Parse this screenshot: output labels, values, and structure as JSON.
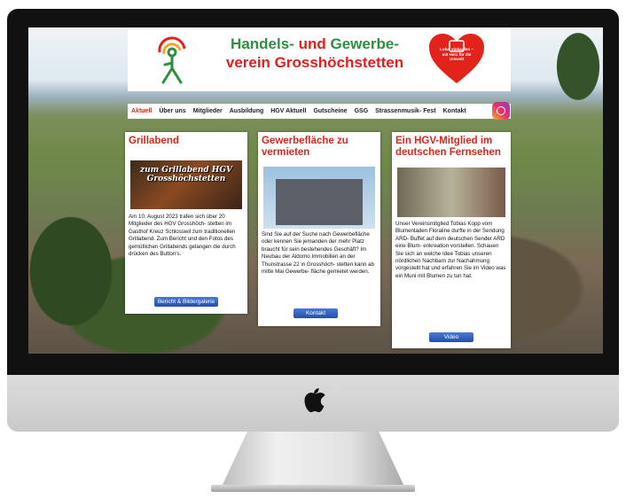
{
  "site": {
    "title_line1_a": "Handels-",
    "title_line1_b": "und",
    "title_line1_c": "Gewerbe-",
    "title_line2": "verein Grosshöchstetten",
    "heart_text": "Lokal einkaufen – mit Herz für die Umwelt"
  },
  "nav": [
    "Aktuell",
    "Über uns",
    "Mitglieder",
    "Ausbildung",
    "HGV Aktuell",
    "Gutscheine",
    "GSG",
    "Strassenmusik- Fest",
    "Kontakt"
  ],
  "cards": [
    {
      "title": "Grillabend",
      "image_text": "zum Grillabend HGV Grosshöchstetten",
      "text": "Am 10. August 2023 trafen sich über 20 Mitglieder des HGV Grosshöch- stetten im Gasthof Kreuz Schlosswil zum traditionellen Grillabend. Zum Bericht und den Fotos des gemütlichen Grillabends gelangen die durch drücken des Button's.",
      "button": "Bericht & Bildergalerie"
    },
    {
      "title": "Gewerbefläche zu vermieten",
      "text": "Sind Sie auf der Suche nach Gewerbefläche oder kennen Sie jemanden der mehr Platz braucht für sein bestehendes Geschäft? Im Neubau der Aldomo Immobilien an der Thunstrasse 22 in Grosshöch- stetten kann ab mitte Mai Gewerbe- fläche gemietet werden.",
      "button": "Kontakt"
    },
    {
      "title": "Ein HGV-Mitglied im deutschen Fernsehen",
      "text": "Unser Vereinsmitglied Tobias Kopp vom Blumenladen Floraline durfte in der Sendung ARD- Buffet auf dem deutschen Sender ARD eine Blum- enkreation vorstellen. Schauen Sie sich an welche Idee Tobias unseren nördlichen Nachbarn zur Nachahmung vorgestellt hat und erfahren Sie im Video was ein Muni mit Blumen zu tun hat.",
      "button": "Video"
    }
  ],
  "colors": {
    "accent_red": "#d52a1a",
    "brand_green": "#2f8f3f",
    "button_blue": "#2f5fc4"
  }
}
